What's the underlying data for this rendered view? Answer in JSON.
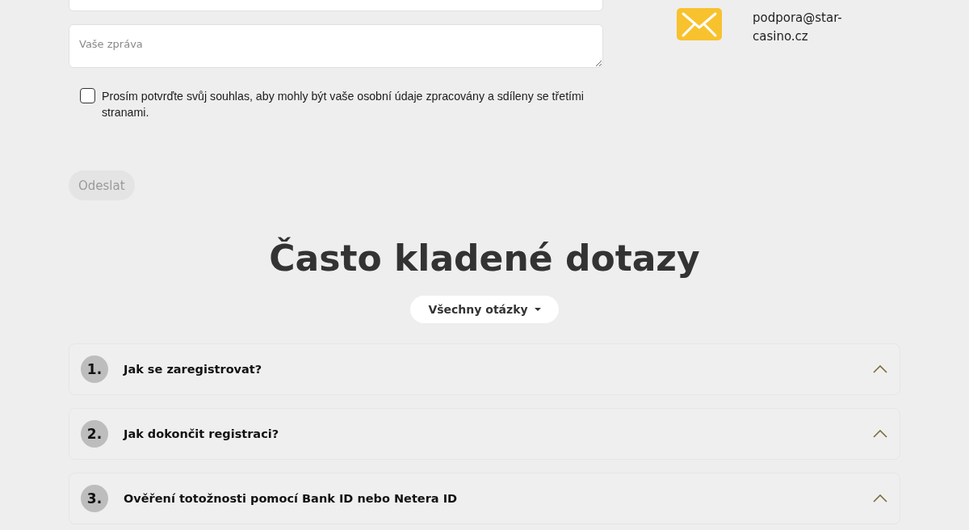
{
  "contact_form": {
    "fields": [
      {
        "kind": "input"
      },
      {
        "kind": "textarea",
        "placeholder": "Vaše zpráva"
      }
    ],
    "consent": {
      "checked": false,
      "label": "Prosím potvrďte svůj souhlas, aby mohly být vaše osobní údaje zpracovány a sdíleny se třetími stranami."
    },
    "submit_button": {
      "label": "Odeslat",
      "disabled": true
    }
  },
  "contact_info": {
    "email": "podpora@star-casino.cz"
  },
  "faq": {
    "title": "Často kladené dotazy",
    "filter": {
      "label": "Všechny otázky"
    },
    "items": [
      {
        "number": "1.",
        "question": "Jak se zaregistrovat?"
      },
      {
        "number": "2.",
        "question": "Jak dokončit registraci?"
      },
      {
        "number": "3.",
        "question": "Ověření totožnosti pomocí Bank ID nebo Netera ID"
      }
    ]
  }
}
